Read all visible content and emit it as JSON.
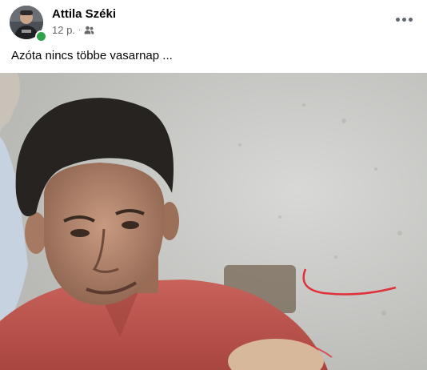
{
  "post": {
    "author": "Attila Széki",
    "time": "12 p.",
    "separator": "·",
    "audience_icon": "friends-icon",
    "text": "Azóta nincs többe vasarnap ...",
    "more_icon": "more-options-icon",
    "photo_description": "old family photograph of a man in a red shirt"
  }
}
